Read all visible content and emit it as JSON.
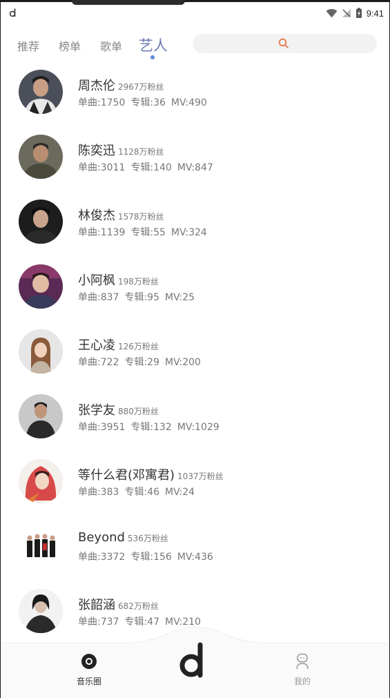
{
  "status_bar": {
    "time": "9:41"
  },
  "tabs": [
    {
      "label": "推荐",
      "active": false
    },
    {
      "label": "榜单",
      "active": false
    },
    {
      "label": "歌单",
      "active": false
    },
    {
      "label": "艺人",
      "active": true
    }
  ],
  "search": {
    "icon": "search-icon"
  },
  "artists": [
    {
      "name": "周杰伦",
      "fans": "2967万粉丝",
      "songs": "单曲:1750",
      "albums": "专辑:36",
      "mvs": "MV:490"
    },
    {
      "name": "陈奕迅",
      "fans": "1128万粉丝",
      "songs": "单曲:3011",
      "albums": "专辑:140",
      "mvs": "MV:847"
    },
    {
      "name": "林俊杰",
      "fans": "1578万粉丝",
      "songs": "单曲:1139",
      "albums": "专辑:55",
      "mvs": "MV:324"
    },
    {
      "name": "小阿枫",
      "fans": "198万粉丝",
      "songs": "单曲:837",
      "albums": "专辑:95",
      "mvs": "MV:25"
    },
    {
      "name": "王心凌",
      "fans": "126万粉丝",
      "songs": "单曲:722",
      "albums": "专辑:29",
      "mvs": "MV:200"
    },
    {
      "name": "张学友",
      "fans": "880万粉丝",
      "songs": "单曲:3951",
      "albums": "专辑:132",
      "mvs": "MV:1029"
    },
    {
      "name": "等什么君(邓寓君)",
      "fans": "1037万粉丝",
      "songs": "单曲:383",
      "albums": "专辑:46",
      "mvs": "MV:24"
    },
    {
      "name": "Beyond",
      "fans": "536万粉丝",
      "songs": "单曲:3372",
      "albums": "专辑:156",
      "mvs": "MV:436"
    },
    {
      "name": "张韶涵",
      "fans": "682万粉丝",
      "songs": "单曲:737",
      "albums": "专辑:47",
      "mvs": "MV:210"
    }
  ],
  "bottom_nav": {
    "left_label": "音乐圈",
    "right_label": "我的"
  },
  "colors": {
    "accent": "#6b7ab4",
    "dot": "#5b8ad8",
    "search_icon": "#e8764a"
  }
}
